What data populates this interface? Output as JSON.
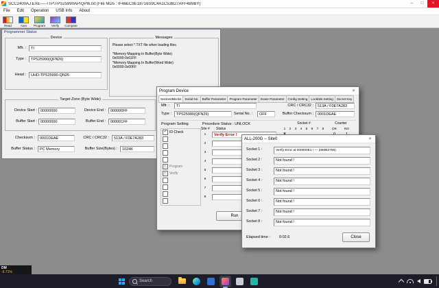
{
  "icons": {
    "minimize": "–",
    "maximize": "□",
    "close": "×"
  },
  "colors": {
    "error_red": "#c80000",
    "close_red": "#e81123"
  },
  "app": {
    "title": "SCC2400AJ.EXE-----\\TP\\TPS25990APIQPI6.txt (File MD5 : IF46EC9E18716S9C4A1C53B27AFF4B9BY)",
    "menu": [
      {
        "label": "File"
      },
      {
        "label": "Edit"
      },
      {
        "label": "Operation"
      },
      {
        "label": "USB Info"
      },
      {
        "label": "About"
      }
    ],
    "toolbar": [
      {
        "label": "Read"
      },
      {
        "label": "Auto"
      },
      {
        "label": "Program"
      },
      {
        "label": "Verify"
      },
      {
        "label": "Compare"
      }
    ],
    "panel_caption": "Programmer Status",
    "device": {
      "title": "Device",
      "mfr_label": "Mfr. :",
      "mfr": "TI",
      "type_label": "Type :",
      "type": "TPS25990(QFN26)",
      "head_label": "Head :",
      "head": "UHD-TPS25990-QN26"
    },
    "messages": {
      "title": "Messages",
      "lines": [
        "Please select *.TXT file when loading files.",
        "*Memory Mapping In Buffer(Byte Wide)",
        "0x0000-0x01FF",
        "*Memory Mapping In Buffer(Word Wide)",
        "0x0000-0x00FF"
      ]
    },
    "target_zone": {
      "title": "Target Zone (Byte Wide)",
      "device_start_label": "Device Start :",
      "device_start": "00000000",
      "device_end_label": "Device End :",
      "device_end": "000000FF",
      "buffer_start_label": "Buffer Start :",
      "buffer_start": "00000000",
      "buffer_end_label": "Buffer End :",
      "buffer_end": "000001FF"
    },
    "checksum_label": "Checksum :",
    "checksum": "0001DEAE",
    "crc_label": "CRC / CRC32 :",
    "crc": "513A / F0E7A283",
    "buffer_status_label": "Buffer Status :",
    "buffer_status": "PC Memory",
    "buffer_size_label": "Buffer Size(Bytes) :",
    "buffer_size": "1024K"
  },
  "program_dialog": {
    "title": "Program Device",
    "tabs": [
      "Sectors/Blocks",
      "Serial No.",
      "Buffer Parameter",
      "Program Parameter",
      "Erase Parameter",
      "Config Setting",
      "Lockbits Setting",
      "Secret Key"
    ],
    "mfr_label": "Mfr. :",
    "mfr": "TI",
    "crc_label": "CRC / CRC32 :",
    "crc": "513A / F0E7A283",
    "type_label": "Type :",
    "type": "TPS25990(QFN26)",
    "serial_label": "Serial No. :",
    "serial": "OFF",
    "buffer_checksum_label": "Buffer Checksum :",
    "buffer_checksum": "0001DEAE",
    "program_setting_label": "Program Setting",
    "checkboxes": [
      {
        "label": "ID Check",
        "mark": "✓"
      },
      {
        "label": "",
        "mark": ""
      },
      {
        "label": "",
        "mark": ""
      },
      {
        "label": "",
        "mark": ""
      },
      {
        "label": "",
        "mark": ""
      },
      {
        "label": "Program",
        "mark": "✓"
      },
      {
        "label": "Verify",
        "mark": "✓"
      },
      {
        "label": "",
        "mark": ""
      },
      {
        "label": "",
        "mark": ""
      },
      {
        "label": "",
        "mark": ""
      },
      {
        "label": "",
        "mark": ""
      }
    ],
    "procedure_status": "Procedure Status :  UNLOCK",
    "site_col_label": "Site #",
    "status_col_label": "Status",
    "site_rows": [
      {
        "num": "1",
        "status": "Verify Error !"
      },
      {
        "num": "2",
        "status": ""
      },
      {
        "num": "3",
        "status": ""
      },
      {
        "num": "4",
        "status": ""
      },
      {
        "num": "5",
        "status": ""
      },
      {
        "num": "6",
        "status": ""
      },
      {
        "num": "7",
        "status": ""
      },
      {
        "num": "8",
        "status": ""
      }
    ],
    "socket_label": "Socket #",
    "counter_label": "Counter",
    "socket_cols": [
      "1",
      "2",
      "3",
      "4",
      "5",
      "6",
      "7",
      "8"
    ],
    "ok_label": "OK",
    "ng_label": "NG",
    "result_row": {
      "marks": [
        "X",
        "",
        "",
        "",
        "",
        "",
        "",
        ""
      ],
      "ok": "0",
      "ng": "1"
    },
    "run_label": "Run"
  },
  "site_dialog": {
    "title": "ALL-200G -- Site0",
    "rows": [
      {
        "label": "Socket 1 :",
        "value": "Verify Error at 000000E1 !  --- (080B2755)"
      },
      {
        "label": "Socket 2 :",
        "value": "Not found !"
      },
      {
        "label": "Socket 3 :",
        "value": "Not found !"
      },
      {
        "label": "Socket 4 :",
        "value": "Not found !"
      },
      {
        "label": "Socket 5 :",
        "value": "Not found !"
      },
      {
        "label": "Socket 6 :",
        "value": "Not found !"
      },
      {
        "label": "Socket 7 :",
        "value": "Not found !"
      },
      {
        "label": "Socket 8 :",
        "value": "Not found !"
      }
    ],
    "elapsed_label": "Elapsed time :",
    "elapsed_value": "0:02.6",
    "close_label": "Close"
  },
  "overlay": {
    "line1": "DM",
    "line2": "-9.71%"
  },
  "taskbar": {
    "search_label": "Search"
  }
}
